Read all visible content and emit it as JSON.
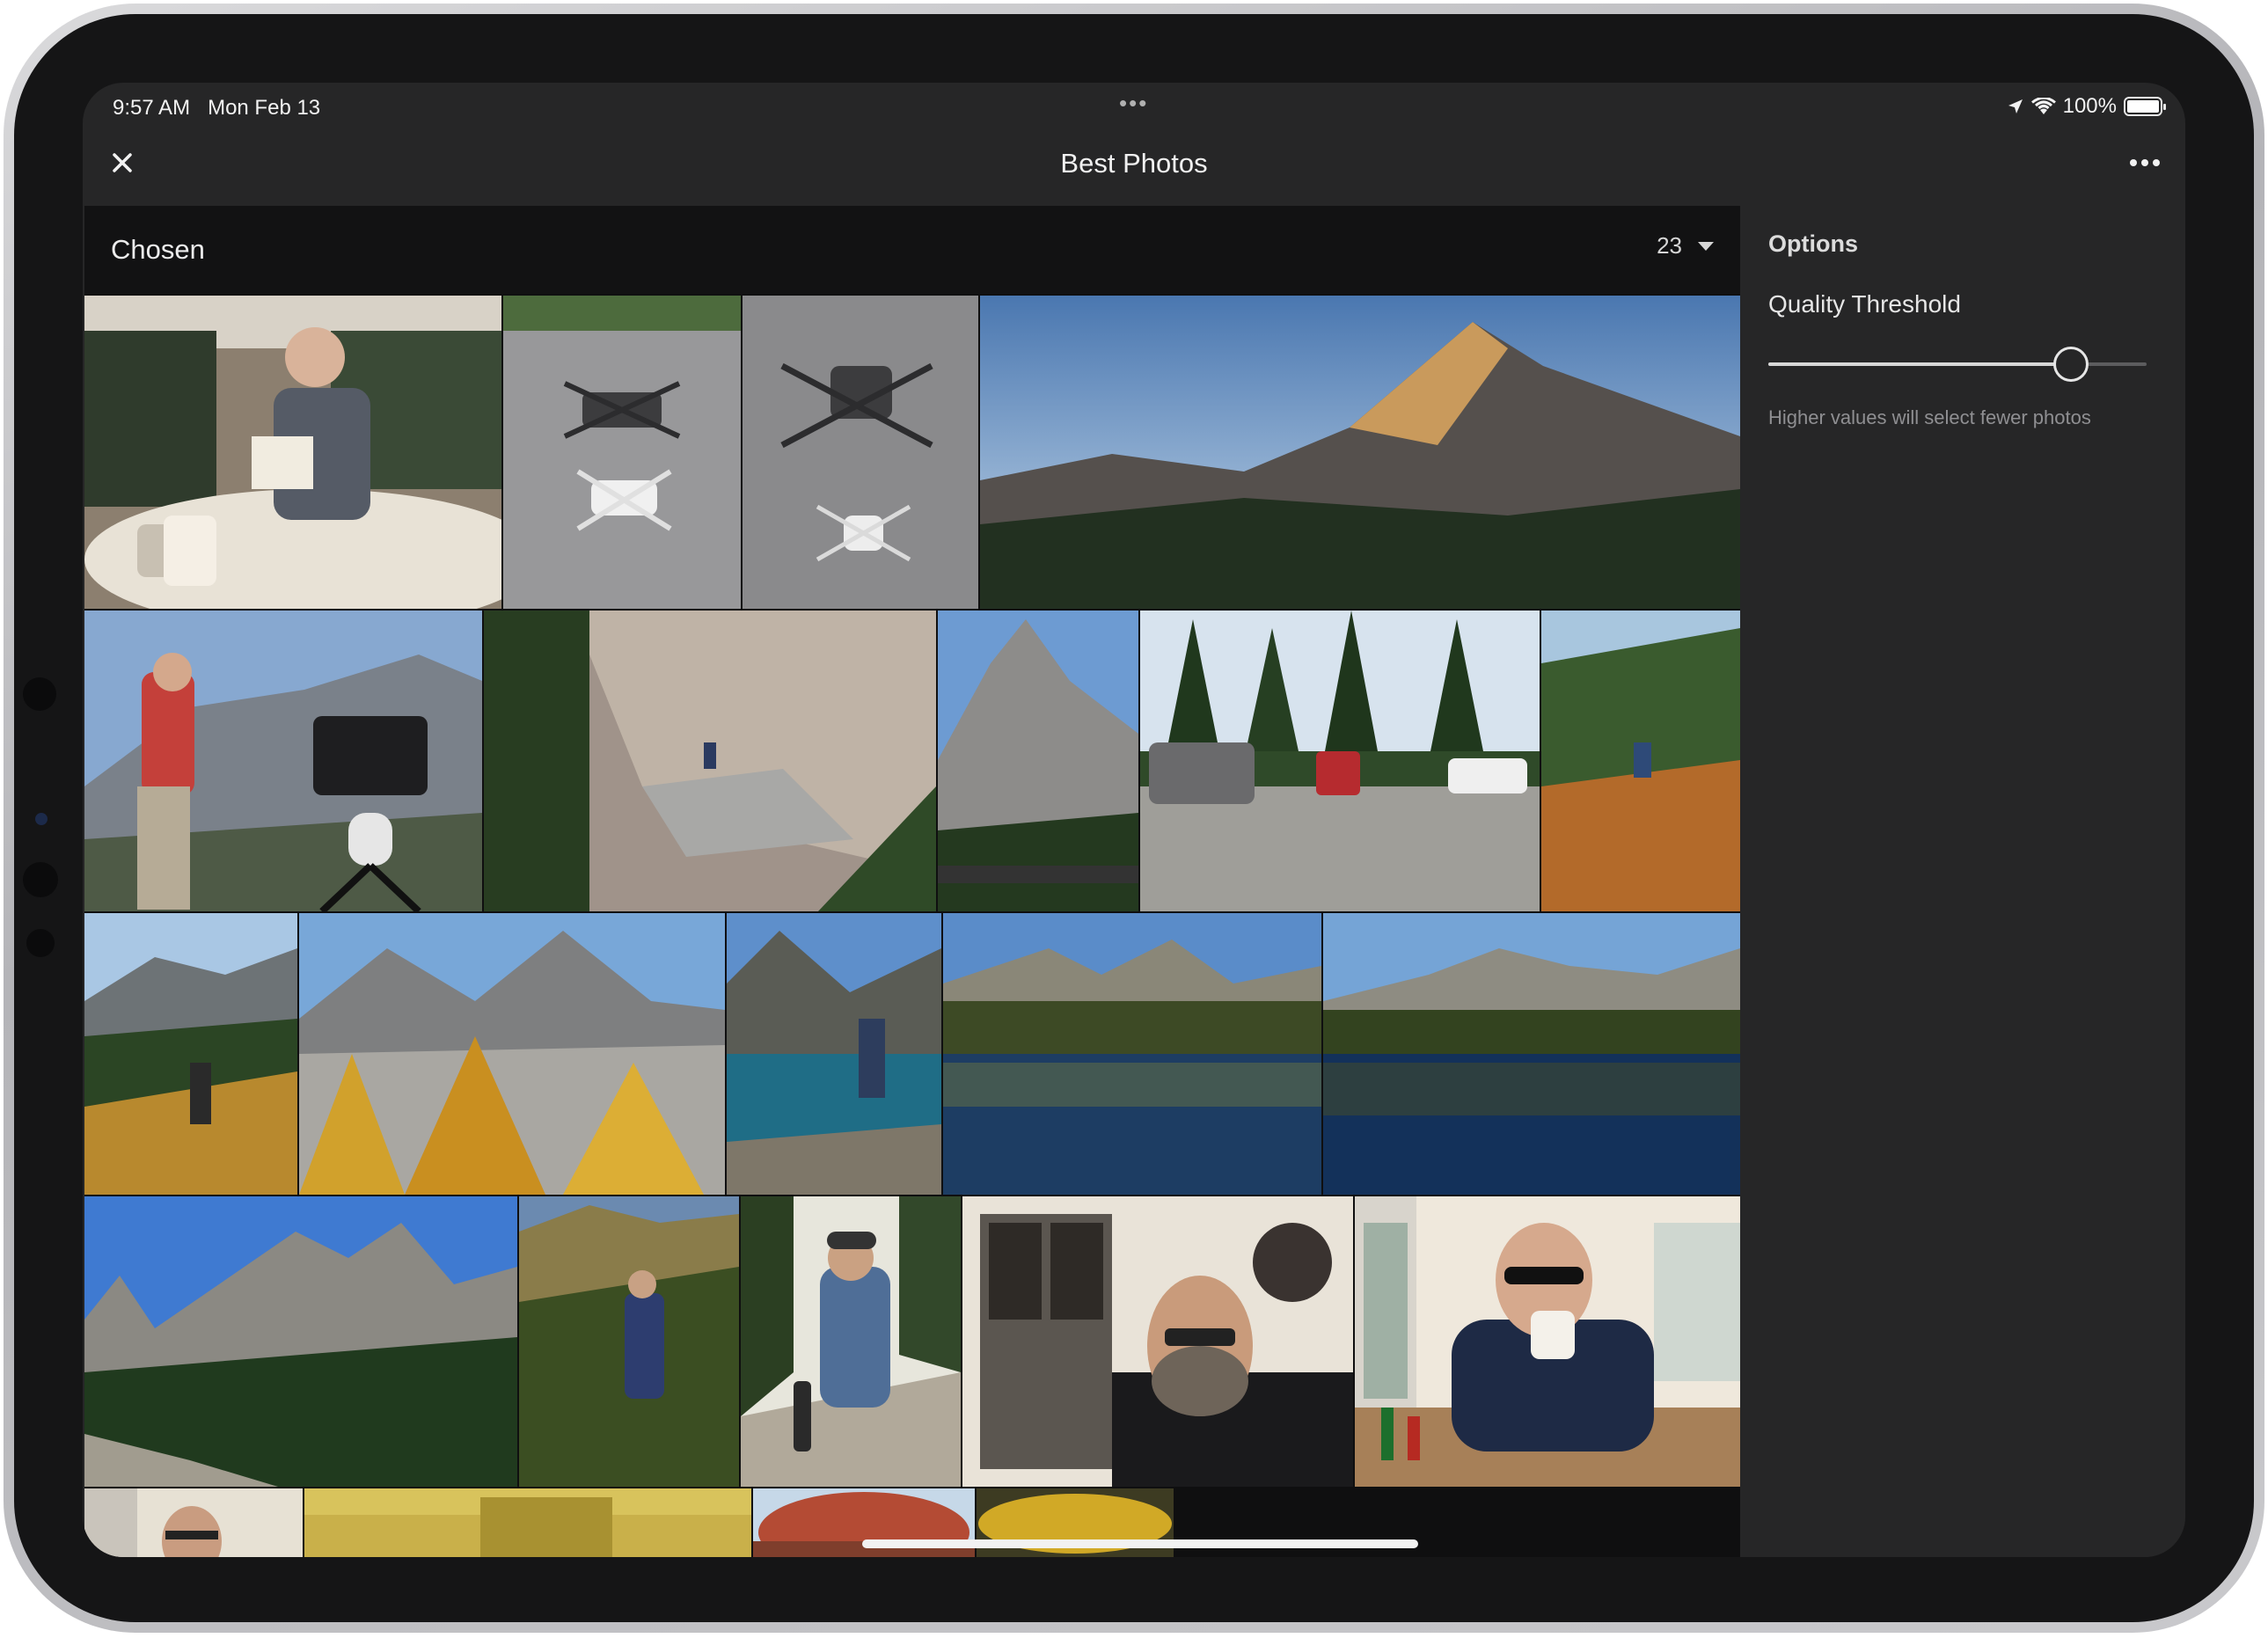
{
  "status_bar": {
    "time": "9:57 AM",
    "date": "Mon Feb 13",
    "battery": "100%"
  },
  "nav": {
    "title": "Best Photos",
    "close_icon": "close-icon",
    "more_icon": "more-horizontal-icon"
  },
  "filter": {
    "label": "Chosen",
    "count": "23"
  },
  "options": {
    "title": "Options",
    "quality_label": "Quality Threshold",
    "slider_value_fraction": 0.8,
    "hint": "Higher values will select fewer photos"
  },
  "photos": [
    {
      "id": "van-reading"
    },
    {
      "id": "drones-pair-1"
    },
    {
      "id": "drones-pair-2"
    },
    {
      "id": "mountain-peak-sunlit"
    },
    {
      "id": "photographer-camera-tripod"
    },
    {
      "id": "rock-face-hiker"
    },
    {
      "id": "granite-spire"
    },
    {
      "id": "vans-parking-lot"
    },
    {
      "id": "hiker-meadow"
    },
    {
      "id": "hiker-larches"
    },
    {
      "id": "larch-valley-peaks"
    },
    {
      "id": "hiker-lake-shore"
    },
    {
      "id": "alpine-lake-reflection-1"
    },
    {
      "id": "alpine-lake-reflection-2"
    },
    {
      "id": "granite-spires-forest"
    },
    {
      "id": "photographer-larch-forest"
    },
    {
      "id": "hiker-cap-trail"
    },
    {
      "id": "selfie-restaurant"
    },
    {
      "id": "man-coffee-mug"
    },
    {
      "id": "man-portrait-partial"
    },
    {
      "id": "autumn-trees"
    },
    {
      "id": "red-tree"
    },
    {
      "id": "yellow-larches"
    }
  ]
}
